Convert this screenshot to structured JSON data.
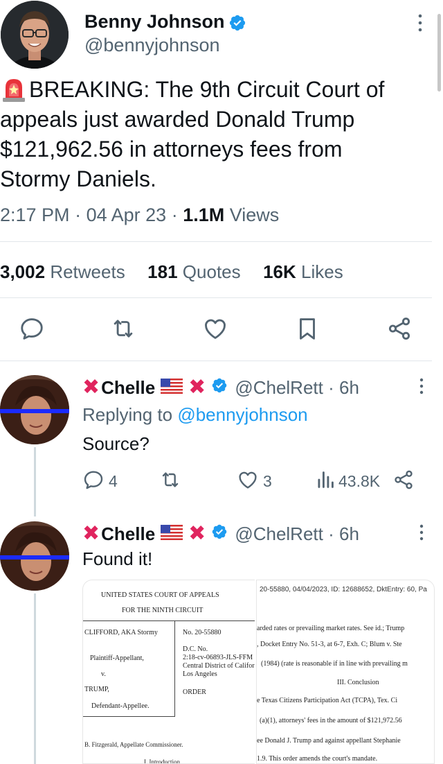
{
  "main_tweet": {
    "author_name": "Benny Johnson",
    "author_handle": "@bennyjohnson",
    "breaking_label": "BREAKING: The 9th Circuit Court of",
    "text_line2": "appeals just awarded Donald Trump",
    "text_line3": "$121,962.56 in attorneys fees from",
    "text_line4": "Stormy Daniels.",
    "time": "2:17 PM",
    "date": "04 Apr 23",
    "views_count": "1.1M",
    "views_label": "Views",
    "retweets_count": "3,002",
    "retweets_label": "Retweets",
    "quotes_count": "181",
    "quotes_label": "Quotes",
    "likes_count": "16K",
    "likes_label": "Likes"
  },
  "reply1": {
    "name": "Chelle",
    "handle": "@ChelRett",
    "age": "6h",
    "replying_prefix": "Replying to",
    "replying_to": "@bennyjohnson",
    "text": "Source?",
    "reply_count": "4",
    "like_count": "3",
    "views_count": "43.8K"
  },
  "reply2": {
    "name": "Chelle",
    "handle": "@ChelRett",
    "age": "6h",
    "text": "Found it!"
  },
  "document_left": {
    "court_title": "UNITED STATES COURT OF APPEALS",
    "circuit": "FOR THE NINTH CIRCUIT",
    "party1": "CLIFFORD, AKA Stormy",
    "party1_role": "Plaintiff-Appellant,",
    "v": "v.",
    "party2": "TRUMP,",
    "party2_role": "Defendant-Appellee.",
    "case_no": "No.   20-55880",
    "dc_no": "D.C. No.",
    "dc_case": "2:18-cv-06893-JLS-FFM",
    "district": "Central District of California,",
    "city": "Los Angeles",
    "order": "ORDER",
    "commissioner": "B. Fitzgerald, Appellate Commissioner.",
    "intro": "I. Introduction"
  },
  "document_right": {
    "header": "20-55880, 04/04/2023, ID: 12688652, DktEntry: 60, Pa",
    "l1": "arded rates or prevailing market rates. See id.; Trump",
    "l2": ", Docket Entry No. 51-3, at 6-7, Exh. C; Blum v. Ste",
    "l3": "(1984) (rate is reasonable if in line with prevailing m",
    "conclusion": "III. Conclusion",
    "l4": "e Texas Citizens Participation Act (TCPA), Tex. Ci",
    "l5": "(a)(1), attorneys' fees in the amount of $121,972.56",
    "l6": "ee Donald J. Trump and against appellant Stephanie",
    "l7": "1.9. This order amends the court's mandate."
  },
  "colors": {
    "accent": "#1d9bf0",
    "verified": "#1d9bf0",
    "muted": "#536471",
    "red_x": "#e0245e"
  }
}
